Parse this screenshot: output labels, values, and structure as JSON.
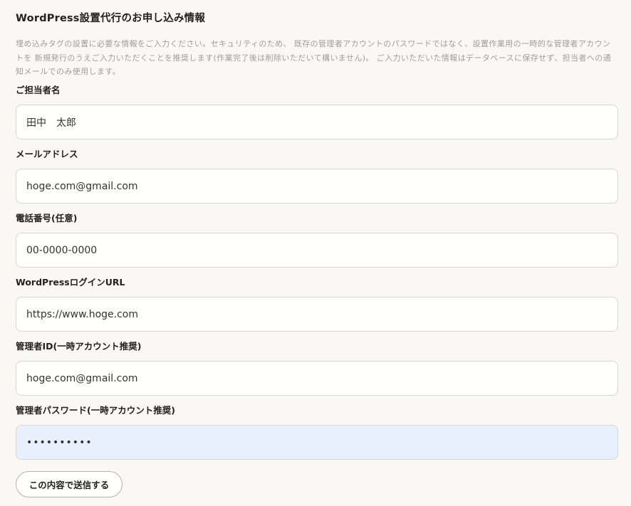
{
  "form": {
    "title": "WordPress設置代行のお申し込み情報",
    "description": "埋め込みタグの設置に必要な情報をご入力ください。セキュリティのため、 既存の管理者アカウントのパスワードではなく、設置作業用の一時的な管理者アカウントを 新規発行のうえご入力いただくことを推奨します(作業完了後は削除いただいて構いません)。 ご入力いただいた情報はデータベースに保存せず、担当者への通知メールでのみ使用します。",
    "fields": [
      {
        "label": "ご担当者名",
        "value": "田中　太郎",
        "type": "text"
      },
      {
        "label": "メールアドレス",
        "value": "hoge.com@gmail.com",
        "type": "email"
      },
      {
        "label": "電話番号(任意)",
        "value": "00-0000-0000",
        "type": "tel"
      },
      {
        "label": "WordPressログインURL",
        "value": "https://www.hoge.com",
        "type": "url"
      },
      {
        "label": "管理者ID(一時アカウント推奨)",
        "value": "hoge.com@gmail.com",
        "type": "text"
      },
      {
        "label": "管理者パスワード(一時アカウント推奨)",
        "value": "••••••••••",
        "type": "password"
      }
    ],
    "submit_label": "この内容で送信する"
  },
  "colors": {
    "background": "#f9f8f4",
    "input_background": "#fffffd",
    "autofill_background": "#e8f0fe",
    "border": "#d7d6d1",
    "description_text": "#a09e99"
  }
}
